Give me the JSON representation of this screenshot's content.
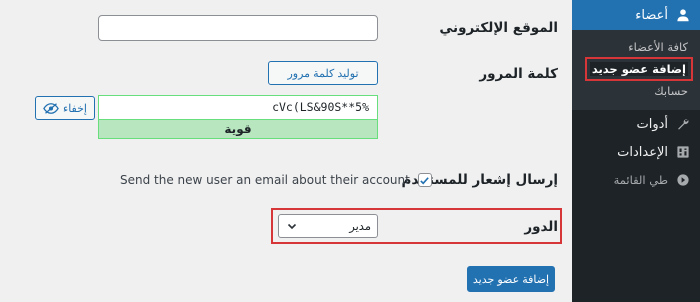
{
  "sidebar": {
    "users_menu": {
      "label": "أعضاء",
      "icon": "user-icon"
    },
    "users_submenu": {
      "all_users": "كافة الأعضاء",
      "add_new": "إضافة عضو جديد",
      "profile": "حسابك"
    },
    "tools": {
      "label": "أدوات",
      "icon": "wrench-icon"
    },
    "settings": {
      "label": "الإعدادات",
      "icon": "settings-icon"
    },
    "collapse": {
      "label": "طي القائمة",
      "icon": "collapse-arrow-icon"
    }
  },
  "form": {
    "website": {
      "label": "الموقع الإلكتروني",
      "value": ""
    },
    "password": {
      "label": "كلمة المرور",
      "generate_button": "توليد كلمة مرور",
      "value": "cVc(LS&90S**5%",
      "strength": "قوية",
      "hide_button": "إخفاء"
    },
    "notify": {
      "label": "إرسال إشعار للمستخدم",
      "checkbox_text": "Send the new user an email about their account",
      "checked": true
    },
    "role": {
      "label": "الدور",
      "selected": "مدير"
    },
    "submit_button": "إضافة عضو جديد"
  },
  "colors": {
    "admin_blue": "#2271b1",
    "sidebar_dark": "#1d2327",
    "highlight_red": "#d63638",
    "strength_green": "#b8e6bf"
  }
}
